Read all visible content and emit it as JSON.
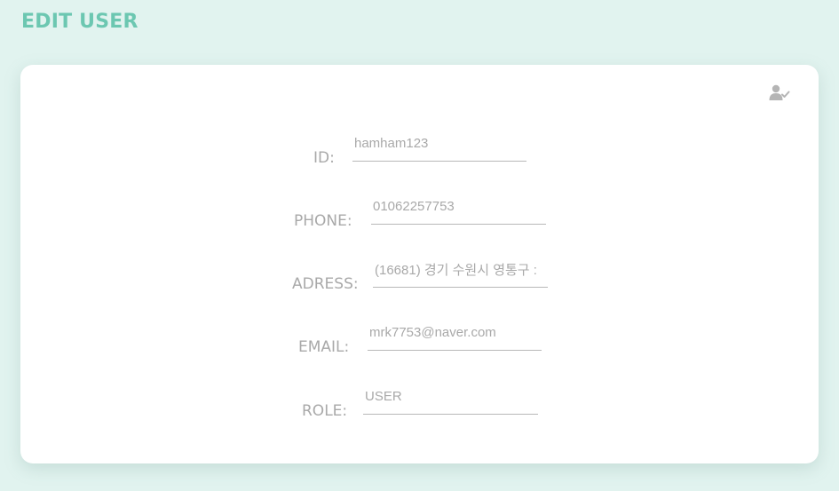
{
  "page": {
    "title": "EDIT USER"
  },
  "actions": {
    "confirm_icon": "user-check-icon"
  },
  "form": {
    "fields": [
      {
        "label": "ID:",
        "value": "hamham123"
      },
      {
        "label": "PHONE:",
        "value": "01062257753"
      },
      {
        "label": "ADRESS:",
        "value": "(16681) 경기 수원시 영통구 :"
      },
      {
        "label": "EMAIL:",
        "value": "mrk7753@naver.com"
      },
      {
        "label": "ROLE:",
        "value": "USER"
      }
    ]
  },
  "colors": {
    "background": "#e1f3ef",
    "accent": "#6cc7b1",
    "card": "#ffffff",
    "text_muted": "#a9a9a9",
    "icon": "#b5b5b5"
  }
}
